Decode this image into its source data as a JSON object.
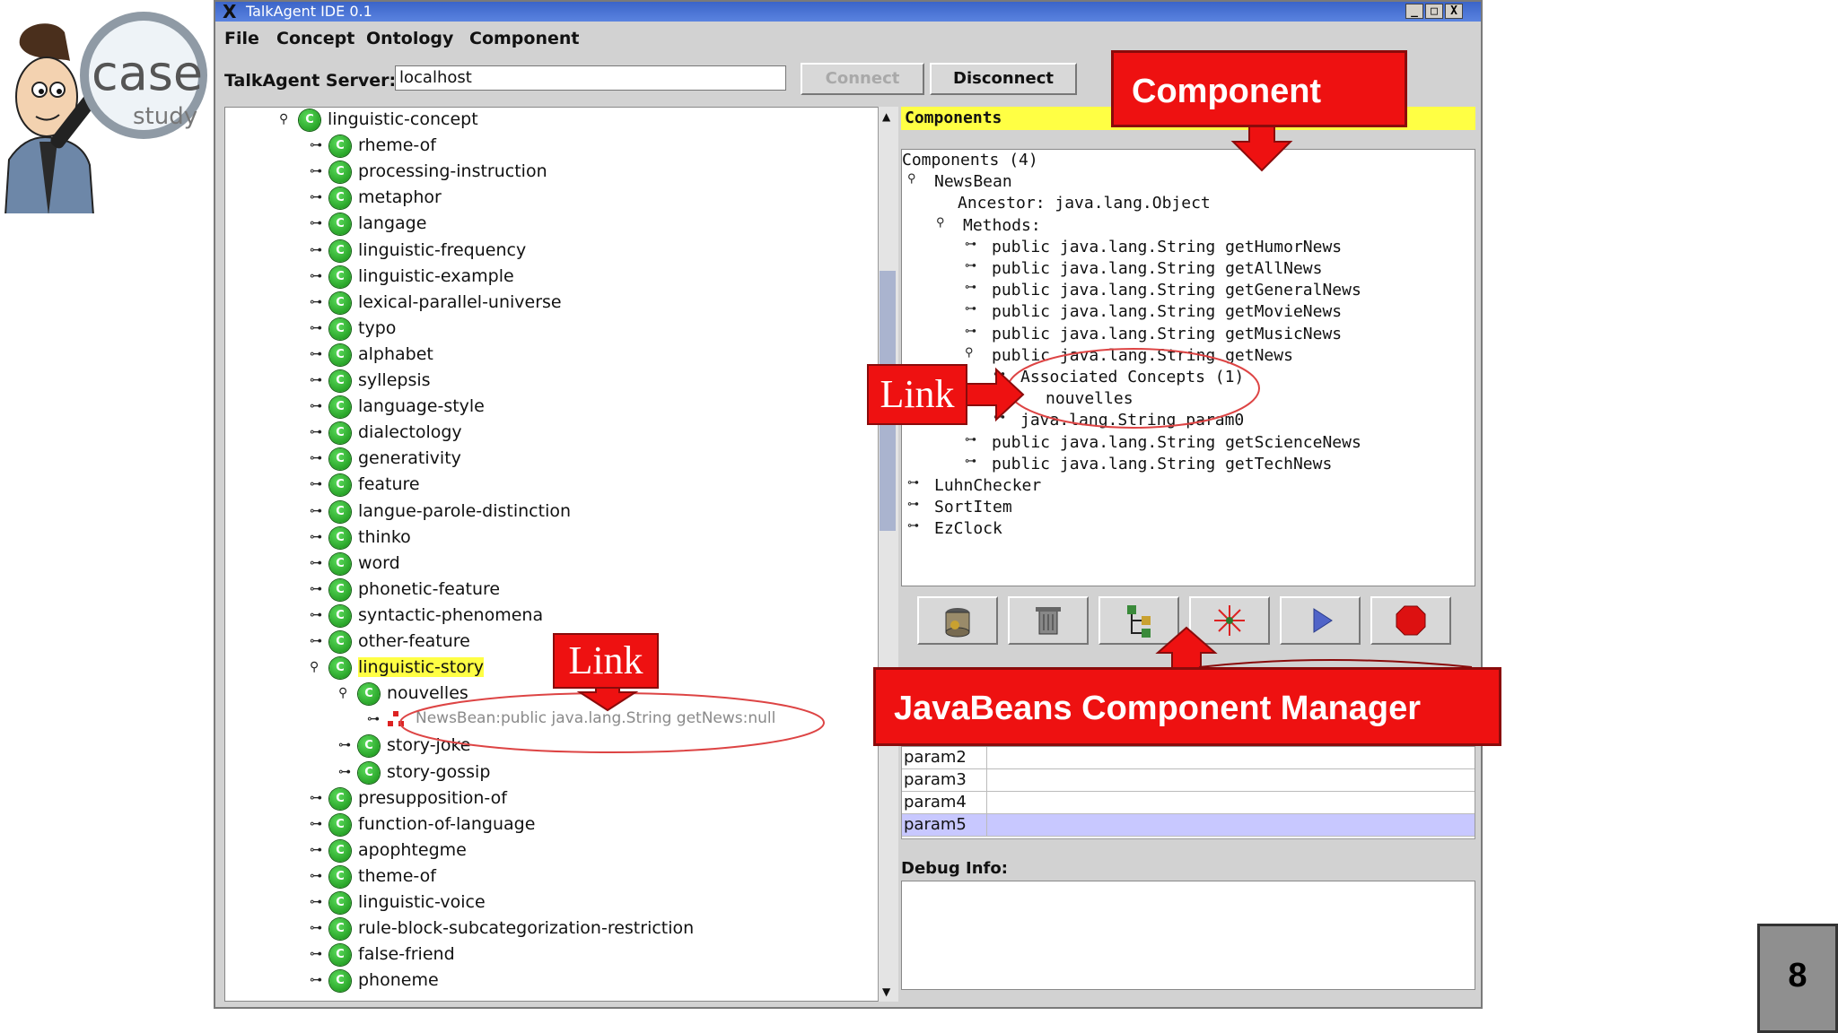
{
  "app": {
    "title": "TalkAgent IDE 0.1",
    "window_buttons": [
      "_",
      "□",
      "X"
    ]
  },
  "menu": [
    "File",
    "Concept",
    "Ontology",
    "Component"
  ],
  "server": {
    "label": "TalkAgent Server:",
    "value": "localhost",
    "connect_label": "Connect",
    "disconnect_label": "Disconnect"
  },
  "concept_tree": {
    "root": "linguistic-concept",
    "items": [
      "rheme-of",
      "processing-instruction",
      "metaphor",
      "langage",
      "linguistic-frequency",
      "linguistic-example",
      "lexical-parallel-universe",
      "typo",
      "alphabet",
      "syllepsis",
      "language-style",
      "dialectology",
      "generativity",
      "feature",
      "langue-parole-distinction",
      "thinko",
      "word",
      "phonetic-feature",
      "syntactic-phenomena",
      "other-feature"
    ],
    "selected": "linguistic-story",
    "selected_child": "nouvelles",
    "link_entry": "NewsBean:public java.lang.String getNews:null",
    "siblings": [
      "story-joke",
      "story-gossip"
    ],
    "items_after": [
      "presupposition-of",
      "function-of-language",
      "apophtegme",
      "theme-of",
      "linguistic-voice",
      "rule-block-subcategorization-restriction",
      "false-friend",
      "phoneme"
    ],
    "node_icon_letter": "C"
  },
  "components_panel": {
    "header": "Components",
    "title": "Components (4)",
    "bean": "NewsBean",
    "ancestor": "Ancestor: java.lang.Object",
    "methods_label": "Methods:",
    "methods_before": [
      "public java.lang.String getHumorNews",
      "public java.lang.String getAllNews",
      "public java.lang.String getGeneralNews",
      "public java.lang.String getMovieNews",
      "public java.lang.String getMusicNews"
    ],
    "expanded_method": "public java.lang.String getNews",
    "associated": "Associated Concepts (1)",
    "associated_item": "nouvelles",
    "param": "java.lang.String param0",
    "methods_after": [
      "public java.lang.String getScienceNews",
      "public java.lang.String getTechNews"
    ],
    "other_components": [
      "LuhnChecker",
      "SortItem",
      "EzClock"
    ]
  },
  "toolbar_icons": [
    "bean-jar-icon",
    "trash-icon",
    "tree-link-icon",
    "sparkle-icon",
    "play-icon",
    "stop-icon"
  ],
  "params": [
    "param2",
    "param3",
    "param4",
    "param5"
  ],
  "debug_label": "Debug Info:",
  "callouts": {
    "component": "Component",
    "jbcm": "JavaBeans Component Manager",
    "link": "Link"
  },
  "logo": {
    "word1": "case",
    "word2": "study"
  },
  "page_number": "8",
  "colors": {
    "callout_red": "#ee1111",
    "header_yellow": "#ffff44",
    "selection_highlight": "#ffff44",
    "node_green": "#138d13",
    "param_selected": "#c8c8ff"
  }
}
